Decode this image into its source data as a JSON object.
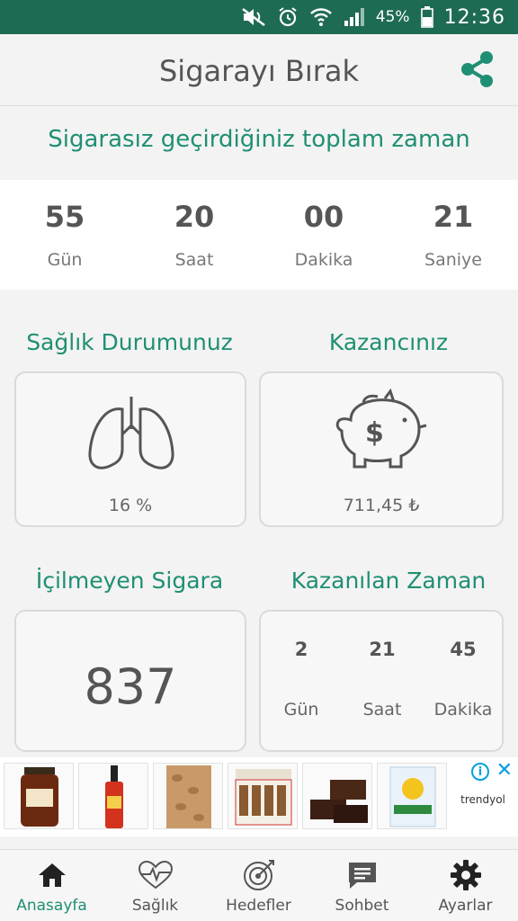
{
  "status_bar": {
    "battery_percent": "45%",
    "time": "12:36",
    "icons": [
      "mute-icon",
      "alarm-icon",
      "wifi-icon",
      "signal-icon",
      "battery-icon"
    ]
  },
  "app_bar": {
    "title": "Sigarayı Bırak",
    "share_icon": "share-icon"
  },
  "total_time": {
    "title": "Sigarasız geçirdiğiniz toplam zaman",
    "cells": [
      {
        "value": "55",
        "label": "Gün"
      },
      {
        "value": "20",
        "label": "Saat"
      },
      {
        "value": "00",
        "label": "Dakika"
      },
      {
        "value": "21",
        "label": "Saniye"
      }
    ]
  },
  "health": {
    "title": "Sağlık Durumunuz",
    "value": "16 %",
    "icon": "lungs-icon"
  },
  "earnings": {
    "title": "Kazancınız",
    "value": "711,45 ₺",
    "icon": "piggy-bank-icon"
  },
  "cigarettes": {
    "title": "İçilmeyen Sigara",
    "value": "837"
  },
  "time_gained": {
    "title": "Kazanılan Zaman",
    "cells": [
      {
        "value": "2",
        "label": "Gün"
      },
      {
        "value": "21",
        "label": "Saat"
      },
      {
        "value": "45",
        "label": "Dakika"
      }
    ]
  },
  "ad": {
    "brand": "trendyol",
    "tiles": [
      "jar-of-honey",
      "drink-bottle",
      "almonds",
      "nutella-box",
      "brownies",
      "yudum-oil"
    ]
  },
  "bottom_nav": {
    "items": [
      {
        "label": "Anasayfa",
        "icon": "home-icon",
        "active": true
      },
      {
        "label": "Sağlık",
        "icon": "heart-pulse-icon",
        "active": false
      },
      {
        "label": "Hedefler",
        "icon": "target-icon",
        "active": false
      },
      {
        "label": "Sohbet",
        "icon": "chat-icon",
        "active": false
      },
      {
        "label": "Ayarlar",
        "icon": "gear-icon",
        "active": false
      }
    ]
  },
  "colors": {
    "accent": "#1f8f74",
    "status_bar": "#1e6b55",
    "text": "#555555"
  }
}
